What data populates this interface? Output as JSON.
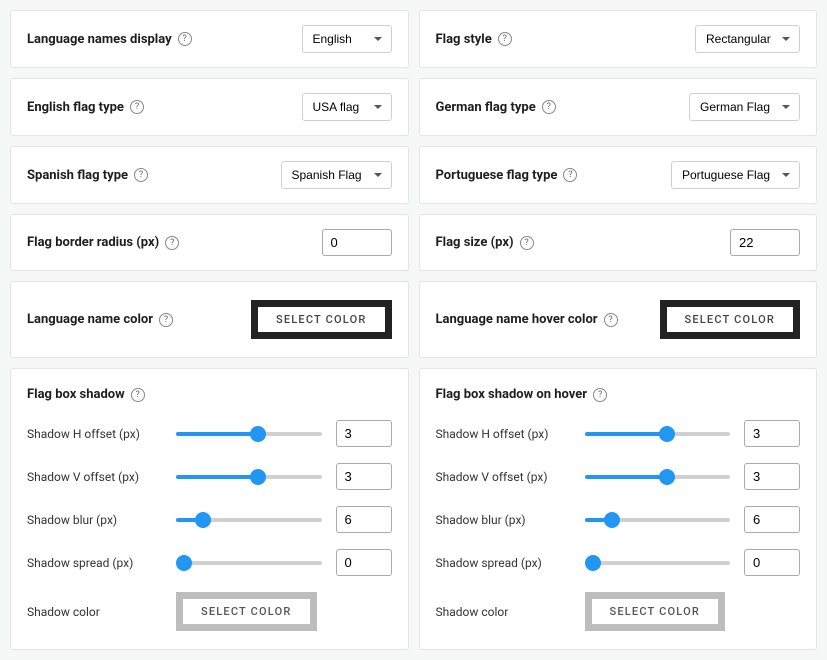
{
  "left": {
    "langDisplay": {
      "label": "Language names display",
      "value": "English"
    },
    "engFlag": {
      "label": "English flag type",
      "value": "USA flag"
    },
    "spaFlag": {
      "label": "Spanish flag type",
      "value": "Spanish Flag"
    },
    "borderRadius": {
      "label": "Flag border radius (px)",
      "value": "0"
    },
    "nameColor": {
      "label": "Language name color",
      "button": "SELECT COLOR"
    },
    "shadow": {
      "title": "Flag box shadow",
      "h": {
        "label": "Shadow H offset (px)",
        "value": "3",
        "min": "-20",
        "max": "20"
      },
      "v": {
        "label": "Shadow V offset (px)",
        "value": "3",
        "min": "-20",
        "max": "20"
      },
      "blur": {
        "label": "Shadow blur (px)",
        "value": "6",
        "min": "0",
        "max": "40"
      },
      "spread": {
        "label": "Shadow spread (px)",
        "value": "0",
        "min": "0",
        "max": "40"
      },
      "color": {
        "label": "Shadow color",
        "button": "SELECT COLOR"
      }
    }
  },
  "right": {
    "flagStyle": {
      "label": "Flag style",
      "value": "Rectangular"
    },
    "gerFlag": {
      "label": "German flag type",
      "value": "German Flag"
    },
    "porFlag": {
      "label": "Portuguese flag type",
      "value": "Portuguese Flag"
    },
    "flagSize": {
      "label": "Flag size (px)",
      "value": "22"
    },
    "nameHoverColor": {
      "label": "Language name hover color",
      "button": "SELECT COLOR"
    },
    "shadow": {
      "title": "Flag box shadow on hover",
      "h": {
        "label": "Shadow H offset (px)",
        "value": "3",
        "min": "-20",
        "max": "20"
      },
      "v": {
        "label": "Shadow V offset (px)",
        "value": "3",
        "min": "-20",
        "max": "20"
      },
      "blur": {
        "label": "Shadow blur (px)",
        "value": "6",
        "min": "0",
        "max": "40"
      },
      "spread": {
        "label": "Shadow spread (px)",
        "value": "0",
        "min": "0",
        "max": "40"
      },
      "color": {
        "label": "Shadow color",
        "button": "SELECT COLOR"
      }
    }
  }
}
